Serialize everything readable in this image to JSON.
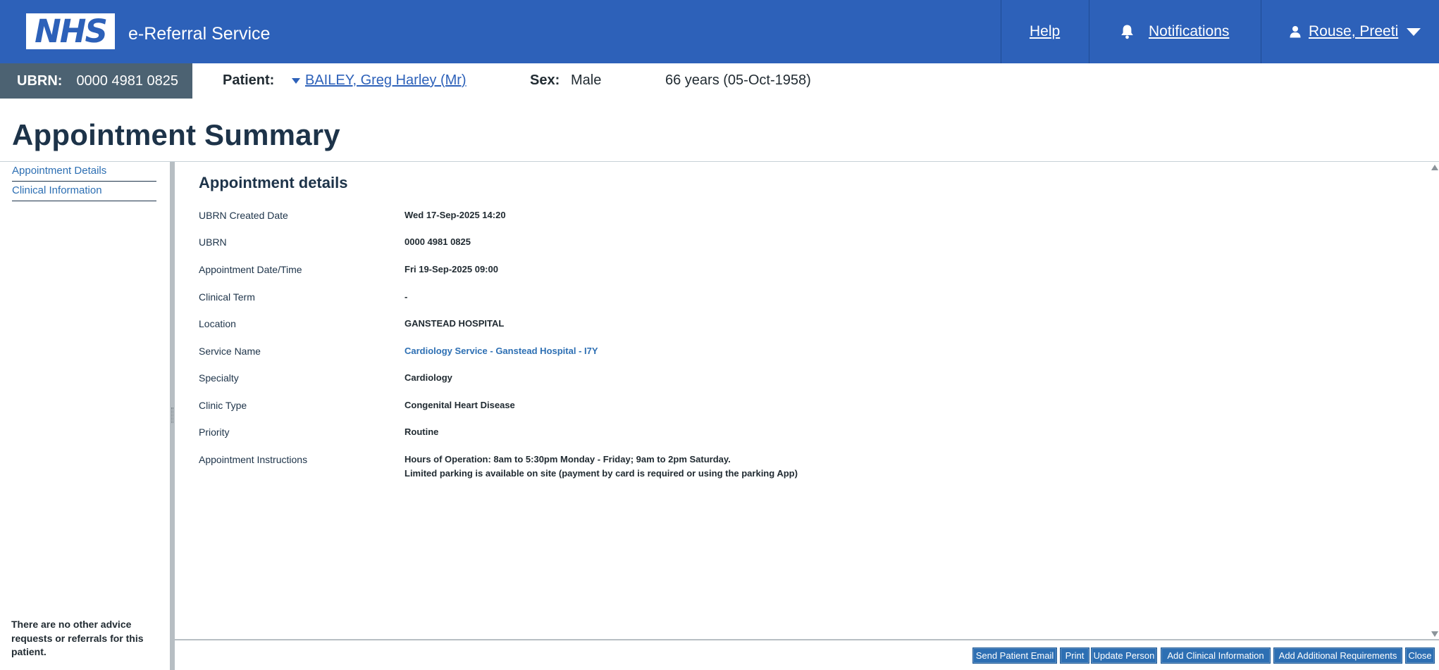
{
  "header": {
    "logo_text": "NHS",
    "service_name": "e-Referral Service",
    "help_label": "Help",
    "notifications_label": "Notifications",
    "user_label": "Rouse, Preeti",
    "icons": {
      "notifications": "bell-icon",
      "user": "user-icon",
      "menu": "caret-down-icon"
    },
    "colors": {
      "brand_blue": "#2d61b9"
    }
  },
  "patient_banner": {
    "ubrn_label": "UBRN:",
    "ubrn_value": "0000 4981 0825",
    "patient_label": "Patient:",
    "patient_name": "BAILEY, Greg Harley (Mr)",
    "sex_label": "Sex:",
    "sex_value": "Male",
    "age_dob": "66 years (05-Oct-1958)"
  },
  "page": {
    "title": "Appointment Summary"
  },
  "side_nav": {
    "items": [
      "Appointment Details",
      "Clinical Information"
    ],
    "note": "There are no other advice requests or referrals for this patient."
  },
  "details": {
    "section_title": "Appointment details",
    "rows": [
      {
        "label": "UBRN Created Date",
        "value": "Wed 17-Sep-2025 14:20"
      },
      {
        "label": "UBRN",
        "value": "0000 4981 0825"
      },
      {
        "label": "Appointment Date/Time",
        "value": "Fri 19-Sep-2025 09:00"
      },
      {
        "label": "Clinical Term",
        "value": "-"
      },
      {
        "label": "Location",
        "value": "GANSTEAD HOSPITAL"
      },
      {
        "label": "Service Name",
        "value": "Cardiology Service - Ganstead Hospital - I7Y"
      },
      {
        "label": "Specialty",
        "value": "Cardiology"
      },
      {
        "label": "Clinic Type",
        "value": "Congenital Heart Disease"
      },
      {
        "label": "Priority",
        "value": "Routine"
      },
      {
        "label": "Appointment Instructions",
        "value": "Hours of Operation: 8am to 5:30pm Monday - Friday; 9am to 2pm Saturday.",
        "value2": "Limited parking is available on site (payment by card is required or using the parking App)"
      }
    ]
  },
  "footer": {
    "buttons": [
      "Send Patient Email",
      "Print",
      "Update Person",
      "Add Clinical Information",
      "Add Additional Requirements",
      "Close"
    ]
  }
}
